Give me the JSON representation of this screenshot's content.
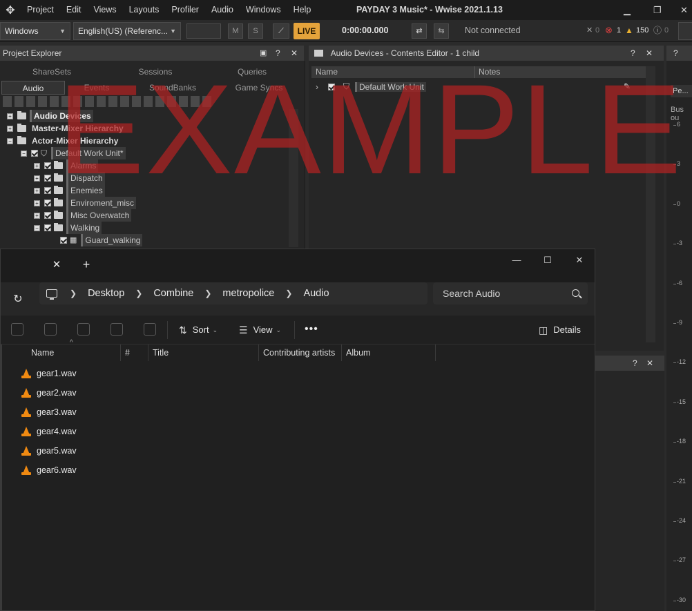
{
  "wwise": {
    "menu": [
      "Project",
      "Edit",
      "Views",
      "Layouts",
      "Profiler",
      "Audio",
      "Windows",
      "Help"
    ],
    "title": "PAYDAY 3 Music* - Wwise 2021.1.13",
    "toolbar": {
      "layout_select": "Windows",
      "language_select": "English(US) (Referenc...",
      "mute_label": "M",
      "solo_label": "S",
      "live_label": "LIVE",
      "time": "0:00:00.000",
      "connection": "Not connected",
      "error_count": "1",
      "warning_count": "150",
      "info_count": "0",
      "x_count": "0"
    },
    "project_explorer": {
      "title": "Project Explorer",
      "tabs_top": [
        "ShareSets",
        "Sessions",
        "Queries"
      ],
      "tabs_bottom": [
        "Audio",
        "Events",
        "SoundBanks",
        "Game Syncs"
      ],
      "tree": [
        {
          "label": "Audio Devices",
          "bold": true
        },
        {
          "label": "Master-Mixer Hierarchy",
          "bold": true
        },
        {
          "label": "Actor-Mixer Hierarchy",
          "bold": true
        },
        {
          "label": "Default Work Unit*"
        },
        {
          "label": "Alarms"
        },
        {
          "label": "Dispatch"
        },
        {
          "label": "Enemies"
        },
        {
          "label": "Enviroment_misc"
        },
        {
          "label": "Misc Overwatch"
        },
        {
          "label": "Walking"
        },
        {
          "label": "Guard_walking"
        }
      ]
    },
    "contents_editor": {
      "title": "Audio Devices - Contents Editor - 1 child",
      "col_name": "Name",
      "col_notes": "Notes",
      "row": "Default Work Unit"
    },
    "right_panel": {
      "tab": "Pe...",
      "label": "Bus ou",
      "scale": [
        "6",
        "3",
        "0",
        "-3",
        "-6",
        "-9",
        "-12",
        "-15",
        "-18",
        "-21",
        "-24",
        "-27",
        "-30"
      ]
    },
    "watermark": "EXAMPLE"
  },
  "explorer": {
    "breadcrumbs": [
      "Desktop",
      "Combine",
      "metropolice",
      "Audio"
    ],
    "search_placeholder": "Search Audio",
    "sort_label": "Sort",
    "view_label": "View",
    "details_label": "Details",
    "columns": [
      "Name",
      "#",
      "Title",
      "Contributing artists",
      "Album"
    ],
    "files": [
      "gear1.wav",
      "gear2.wav",
      "gear3.wav",
      "gear4.wav",
      "gear5.wav",
      "gear6.wav"
    ]
  }
}
